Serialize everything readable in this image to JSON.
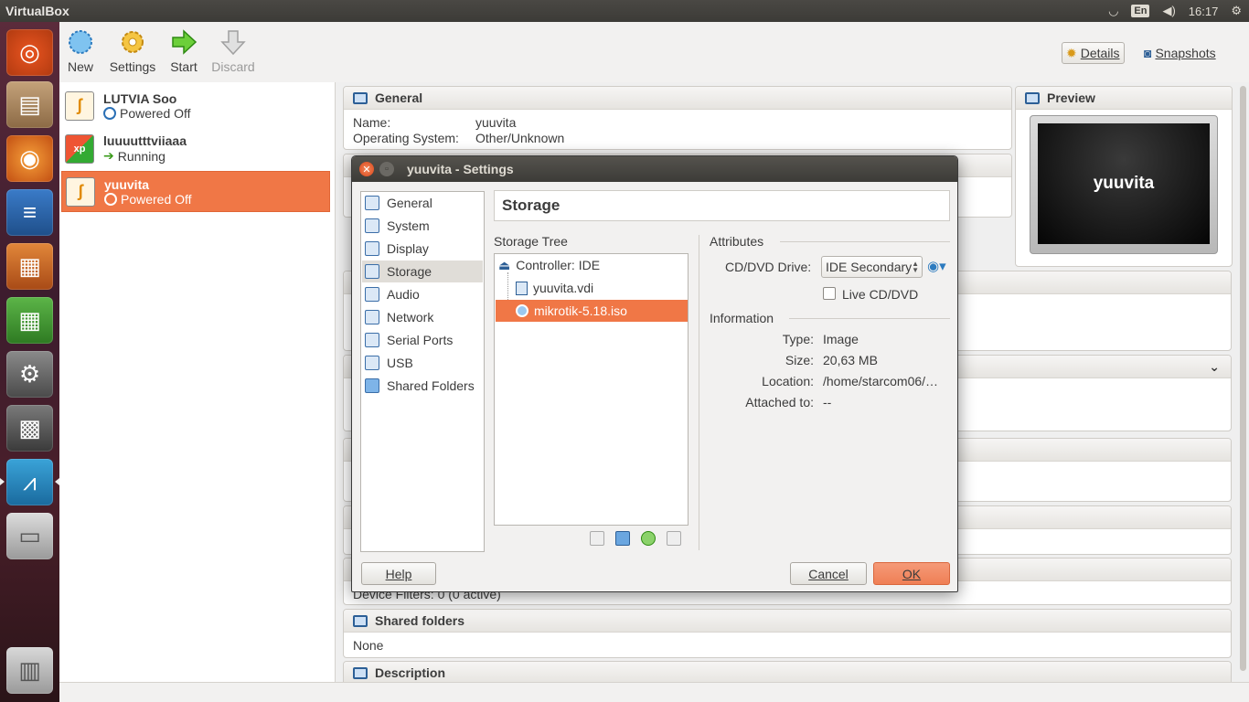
{
  "topbar": {
    "app_title": "VirtualBox",
    "lang": "En",
    "time": "16:17"
  },
  "toolbar": {
    "new_label": "New",
    "settings_label": "Settings",
    "start_label": "Start",
    "discard_label": "Discard",
    "details_label": "Details",
    "snapshots_label": "Snapshots"
  },
  "vms": [
    {
      "name": "LUTVIA Soo",
      "state": "Powered Off"
    },
    {
      "name": "luuuutttviiaaa",
      "state": "Running"
    },
    {
      "name": "yuuvita",
      "state": "Powered Off"
    }
  ],
  "details": {
    "general_title": "General",
    "name_label": "Name:",
    "name_value": "yuuvita",
    "os_label": "Operating System:",
    "os_value": "Other/Unknown",
    "preview_title": "Preview",
    "preview_text": "yuuvita",
    "usb_partial": "Device Filters:   0 (0 active)",
    "shared_title": "Shared folders",
    "shared_value": "None",
    "description_title": "Description"
  },
  "dialog": {
    "title": "yuuvita - Settings",
    "categories": [
      "General",
      "System",
      "Display",
      "Storage",
      "Audio",
      "Network",
      "Serial Ports",
      "USB",
      "Shared Folders"
    ],
    "page_title": "Storage",
    "storage_tree_label": "Storage Tree",
    "tree": {
      "controller": "Controller: IDE",
      "disk": "yuuvita.vdi",
      "iso": "mikrotik-5.18.iso"
    },
    "attributes_label": "Attributes",
    "cd_drive_label": "CD/DVD Drive:",
    "cd_drive_value": "IDE Secondary",
    "live_cd_label": "Live CD/DVD",
    "information_label": "Information",
    "info": {
      "type_label": "Type:",
      "type_value": "Image",
      "size_label": "Size:",
      "size_value": "20,63 MB",
      "location_label": "Location:",
      "location_value": "/home/starcom06/…",
      "attached_label": "Attached to:",
      "attached_value": "--"
    },
    "help_label": "Help",
    "cancel_label": "Cancel",
    "ok_label": "OK"
  }
}
